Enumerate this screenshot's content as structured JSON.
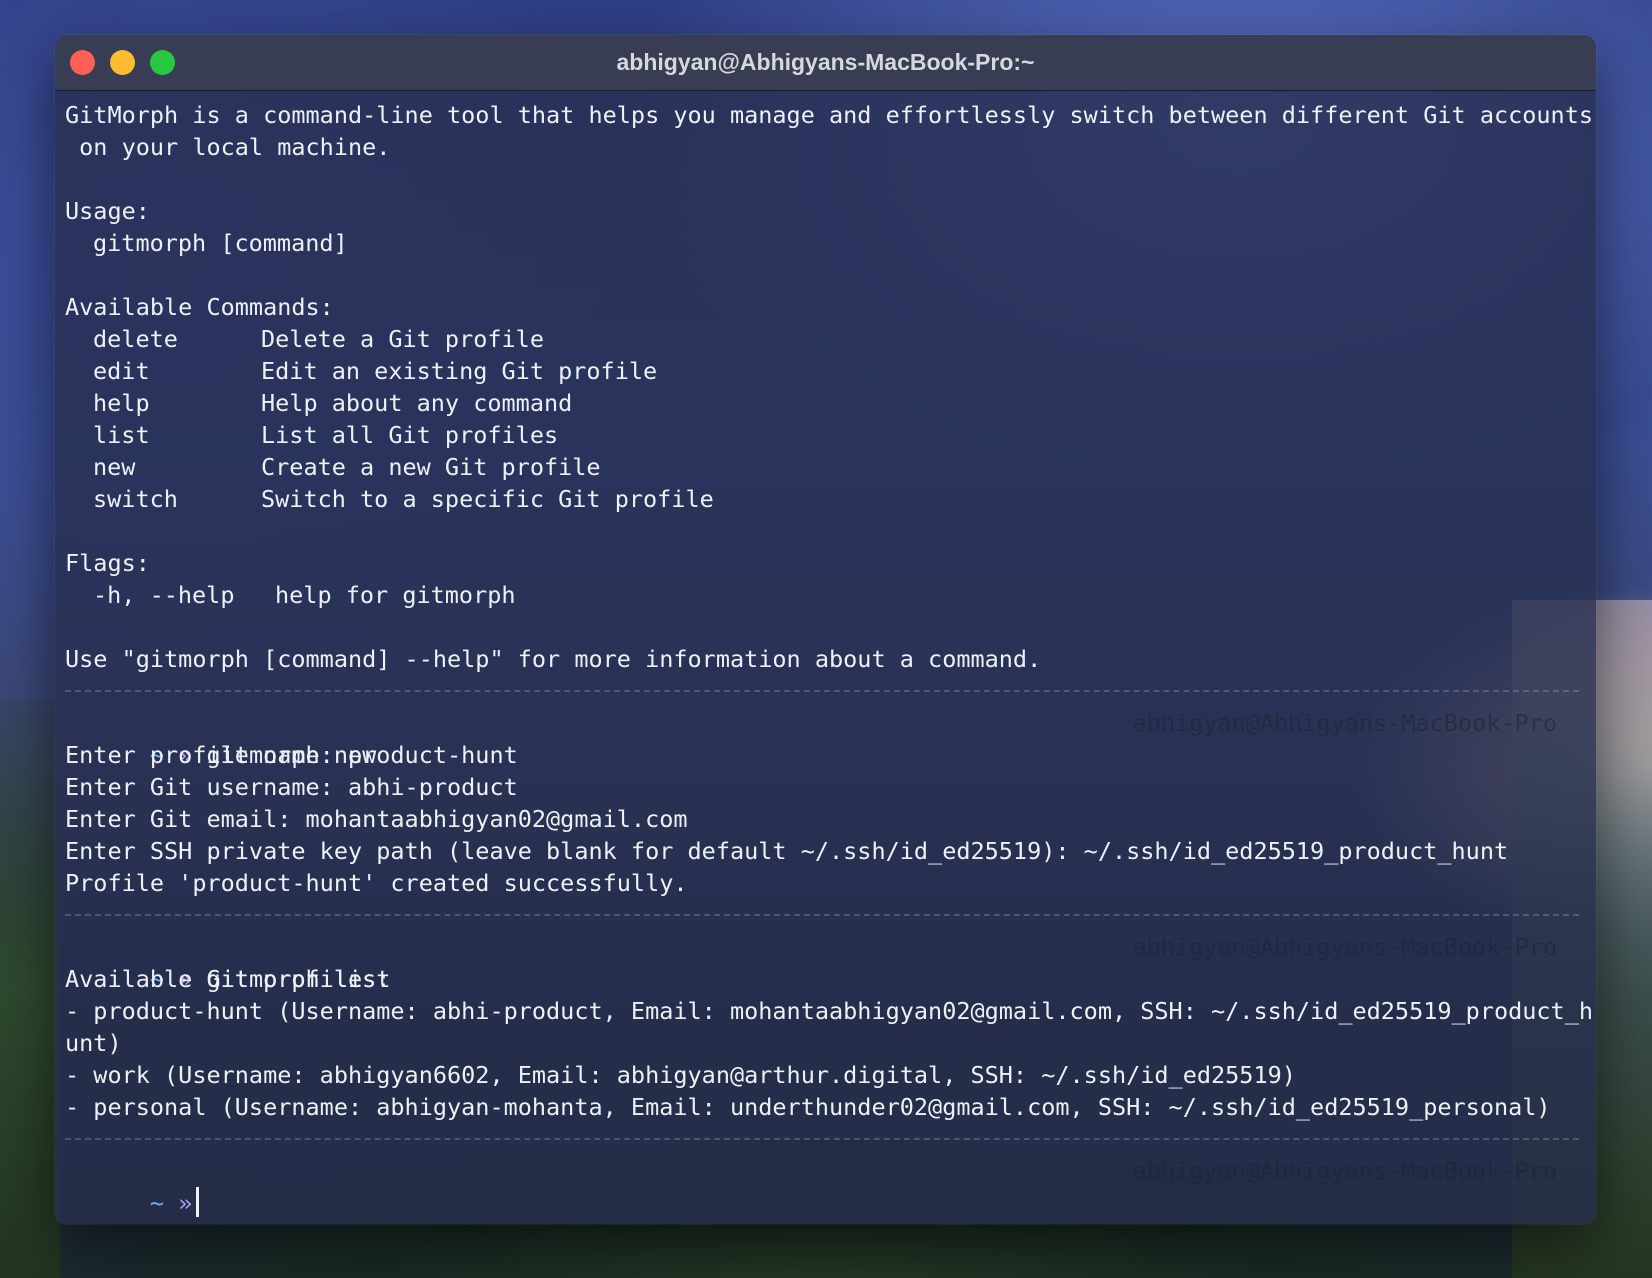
{
  "window": {
    "title": "abhigyan@Abhigyans-MacBook-Pro:~"
  },
  "colors": {
    "close": "#fe5f57",
    "minimize": "#febc2e",
    "zoom": "#28c840",
    "prompt_tilde": "#6ab0f3",
    "prompt_arrow": "#b39cf5",
    "text": "#eef0f4"
  },
  "help": {
    "description_line1": "GitMorph is a command-line tool that helps you manage and effortlessly switch between different Git accounts",
    "description_line2": " on your local machine.",
    "usage_heading": "Usage:",
    "usage_line": "gitmorph [command]",
    "commands_heading": "Available Commands:",
    "commands": [
      {
        "name": "delete",
        "desc": "Delete a Git profile"
      },
      {
        "name": "edit",
        "desc": "Edit an existing Git profile"
      },
      {
        "name": "help",
        "desc": "Help about any command"
      },
      {
        "name": "list",
        "desc": "List all Git profiles"
      },
      {
        "name": "new",
        "desc": "Create a new Git profile"
      },
      {
        "name": "switch",
        "desc": "Switch to a specific Git profile"
      }
    ],
    "flags_heading": "Flags:",
    "flag_name": "-h, --help",
    "flag_desc": "help for gitmorph",
    "footer": "Use \"gitmorph [command] --help\" for more information about a command."
  },
  "prompt": {
    "tilde": "~",
    "arrow": "»",
    "host": "abhigyan@Abhigyans-MacBook-Pro"
  },
  "session_new": {
    "command": "gitmorph new",
    "lines": [
      "Enter profile name: product-hunt",
      "Enter Git username: abhi-product",
      "Enter Git email: mohantaabhigyan02@gmail.com",
      "Enter SSH private key path (leave blank for default ~/.ssh/id_ed25519): ~/.ssh/id_ed25519_product_hunt",
      "Profile 'product-hunt' created successfully."
    ]
  },
  "session_list": {
    "command": "gitmorph list",
    "lines": [
      "Available Git profiles:",
      "- product-hunt (Username: abhi-product, Email: mohantaabhigyan02@gmail.com, SSH: ~/.ssh/id_ed25519_product_h",
      "unt)",
      "- work (Username: abhigyan6602, Email: abhigyan@arthur.digital, SSH: ~/.ssh/id_ed25519)",
      "- personal (Username: abhigyan-mohanta, Email: underthunder02@gmail.com, SSH: ~/.ssh/id_ed25519_personal)"
    ]
  }
}
